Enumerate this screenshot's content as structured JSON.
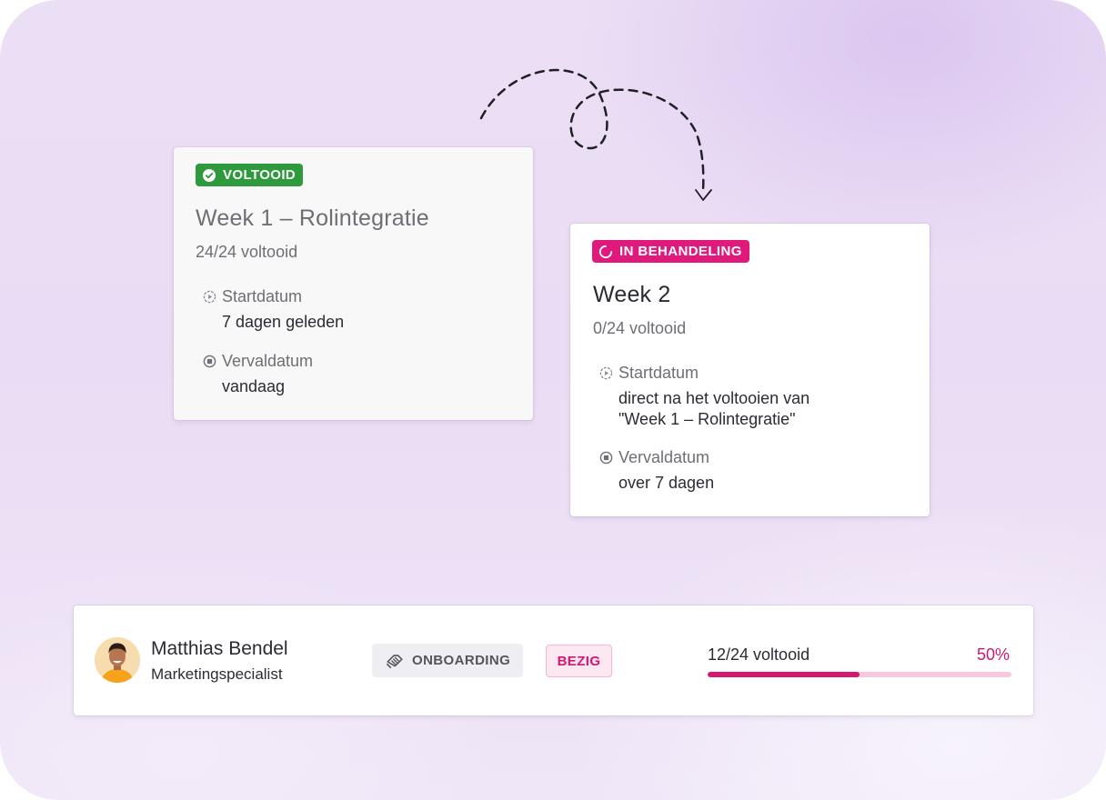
{
  "flow": {
    "completed_card": {
      "badge": "VOLTOOID",
      "title": "Week 1 – Rolintegratie",
      "progress": "24/24 voltooid",
      "start_label": "Startdatum",
      "start_value": "7 dagen geleden",
      "due_label": "Vervaldatum",
      "due_value": "vandaag",
      "badge_color": "#2e9a3d"
    },
    "active_card": {
      "badge": "IN BEHANDELING",
      "title": "Week 2",
      "progress": "0/24 voltooid",
      "start_label": "Startdatum",
      "start_value_line1": "direct na het voltooien van",
      "start_value_line2": "\"Week 1 – Rolintegratie\"",
      "due_label": "Vervaldatum",
      "due_value": "over 7 dagen",
      "badge_color": "#e0197c"
    }
  },
  "person": {
    "name": "Matthias Bendel",
    "role": "Marketingspecialist",
    "program_tag": "ONBOARDING",
    "program_icon": "handshake-icon",
    "status_tag": "BEZIG",
    "progress_text": "12/24 voltooid",
    "progress_percent_text": "50%",
    "progress_fraction": 0.5,
    "accent_color": "#d4176f"
  }
}
